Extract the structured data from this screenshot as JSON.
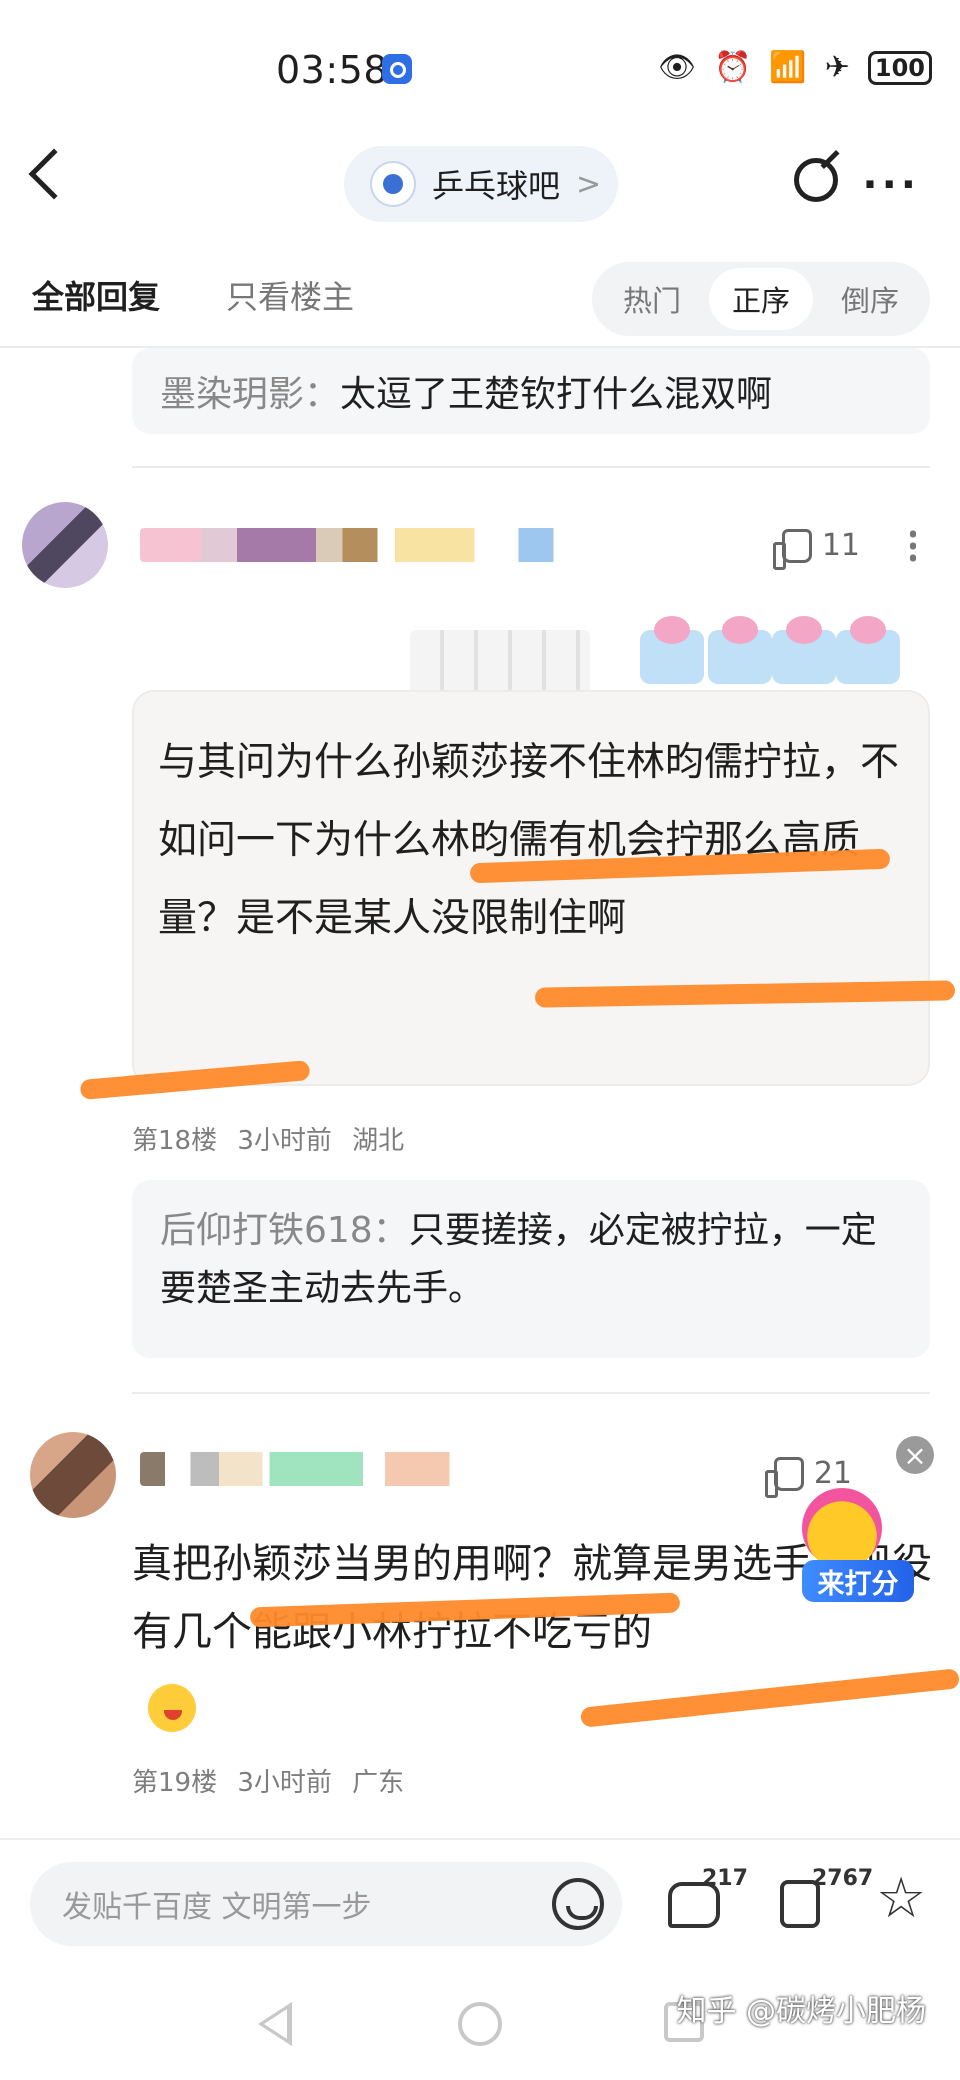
{
  "status_bar": {
    "time": "03:58",
    "battery": "100"
  },
  "header": {
    "forum_name": "乒乓球吧",
    "chevron": ">"
  },
  "tabs": {
    "all_replies": "全部回复",
    "only_op": "只看楼主",
    "sort_options": [
      "热门",
      "正序",
      "倒序"
    ],
    "active_sort": "正序"
  },
  "quote_1": {
    "name": "墨染玥影",
    "text": "太逗了王楚钦打什么混双啊"
  },
  "floor_18": {
    "likes": "11",
    "body": "与其问为什么孙颖莎接不住林昀儒拧拉，不如问一下为什么林昀儒有机会拧那么高质量？是不是某人没限制住啊",
    "meta": {
      "floor": "第18楼",
      "time": "3小时前",
      "location": "湖北"
    },
    "quote": {
      "name": "后仰打铁618",
      "text": "只要搓接，必定被拧拉，一定要楚圣主动去先手。"
    }
  },
  "floor_19": {
    "likes": "21",
    "body": "真把孙颖莎当男的用啊？就算是男选手，现役有几个能跟小林拧拉不吃亏的",
    "meta": {
      "floor": "第19楼",
      "time": "3小时前",
      "location": "广东"
    }
  },
  "widget": {
    "label": "来打分",
    "close": "×"
  },
  "bottom_bar": {
    "input_placeholder": "发贴千百度 文明第一步",
    "comment_count": "217",
    "like_count": "2767"
  },
  "watermark": "知乎 @碳烤小肥杨",
  "colors": {
    "highlight": "#ff8a2b",
    "accent": "#2362e8"
  },
  "icons": [
    "back-icon",
    "edit-icon",
    "more-icon",
    "thumb-up-icon",
    "kebab-icon",
    "emoji-icon",
    "comment-icon",
    "star-icon"
  ]
}
